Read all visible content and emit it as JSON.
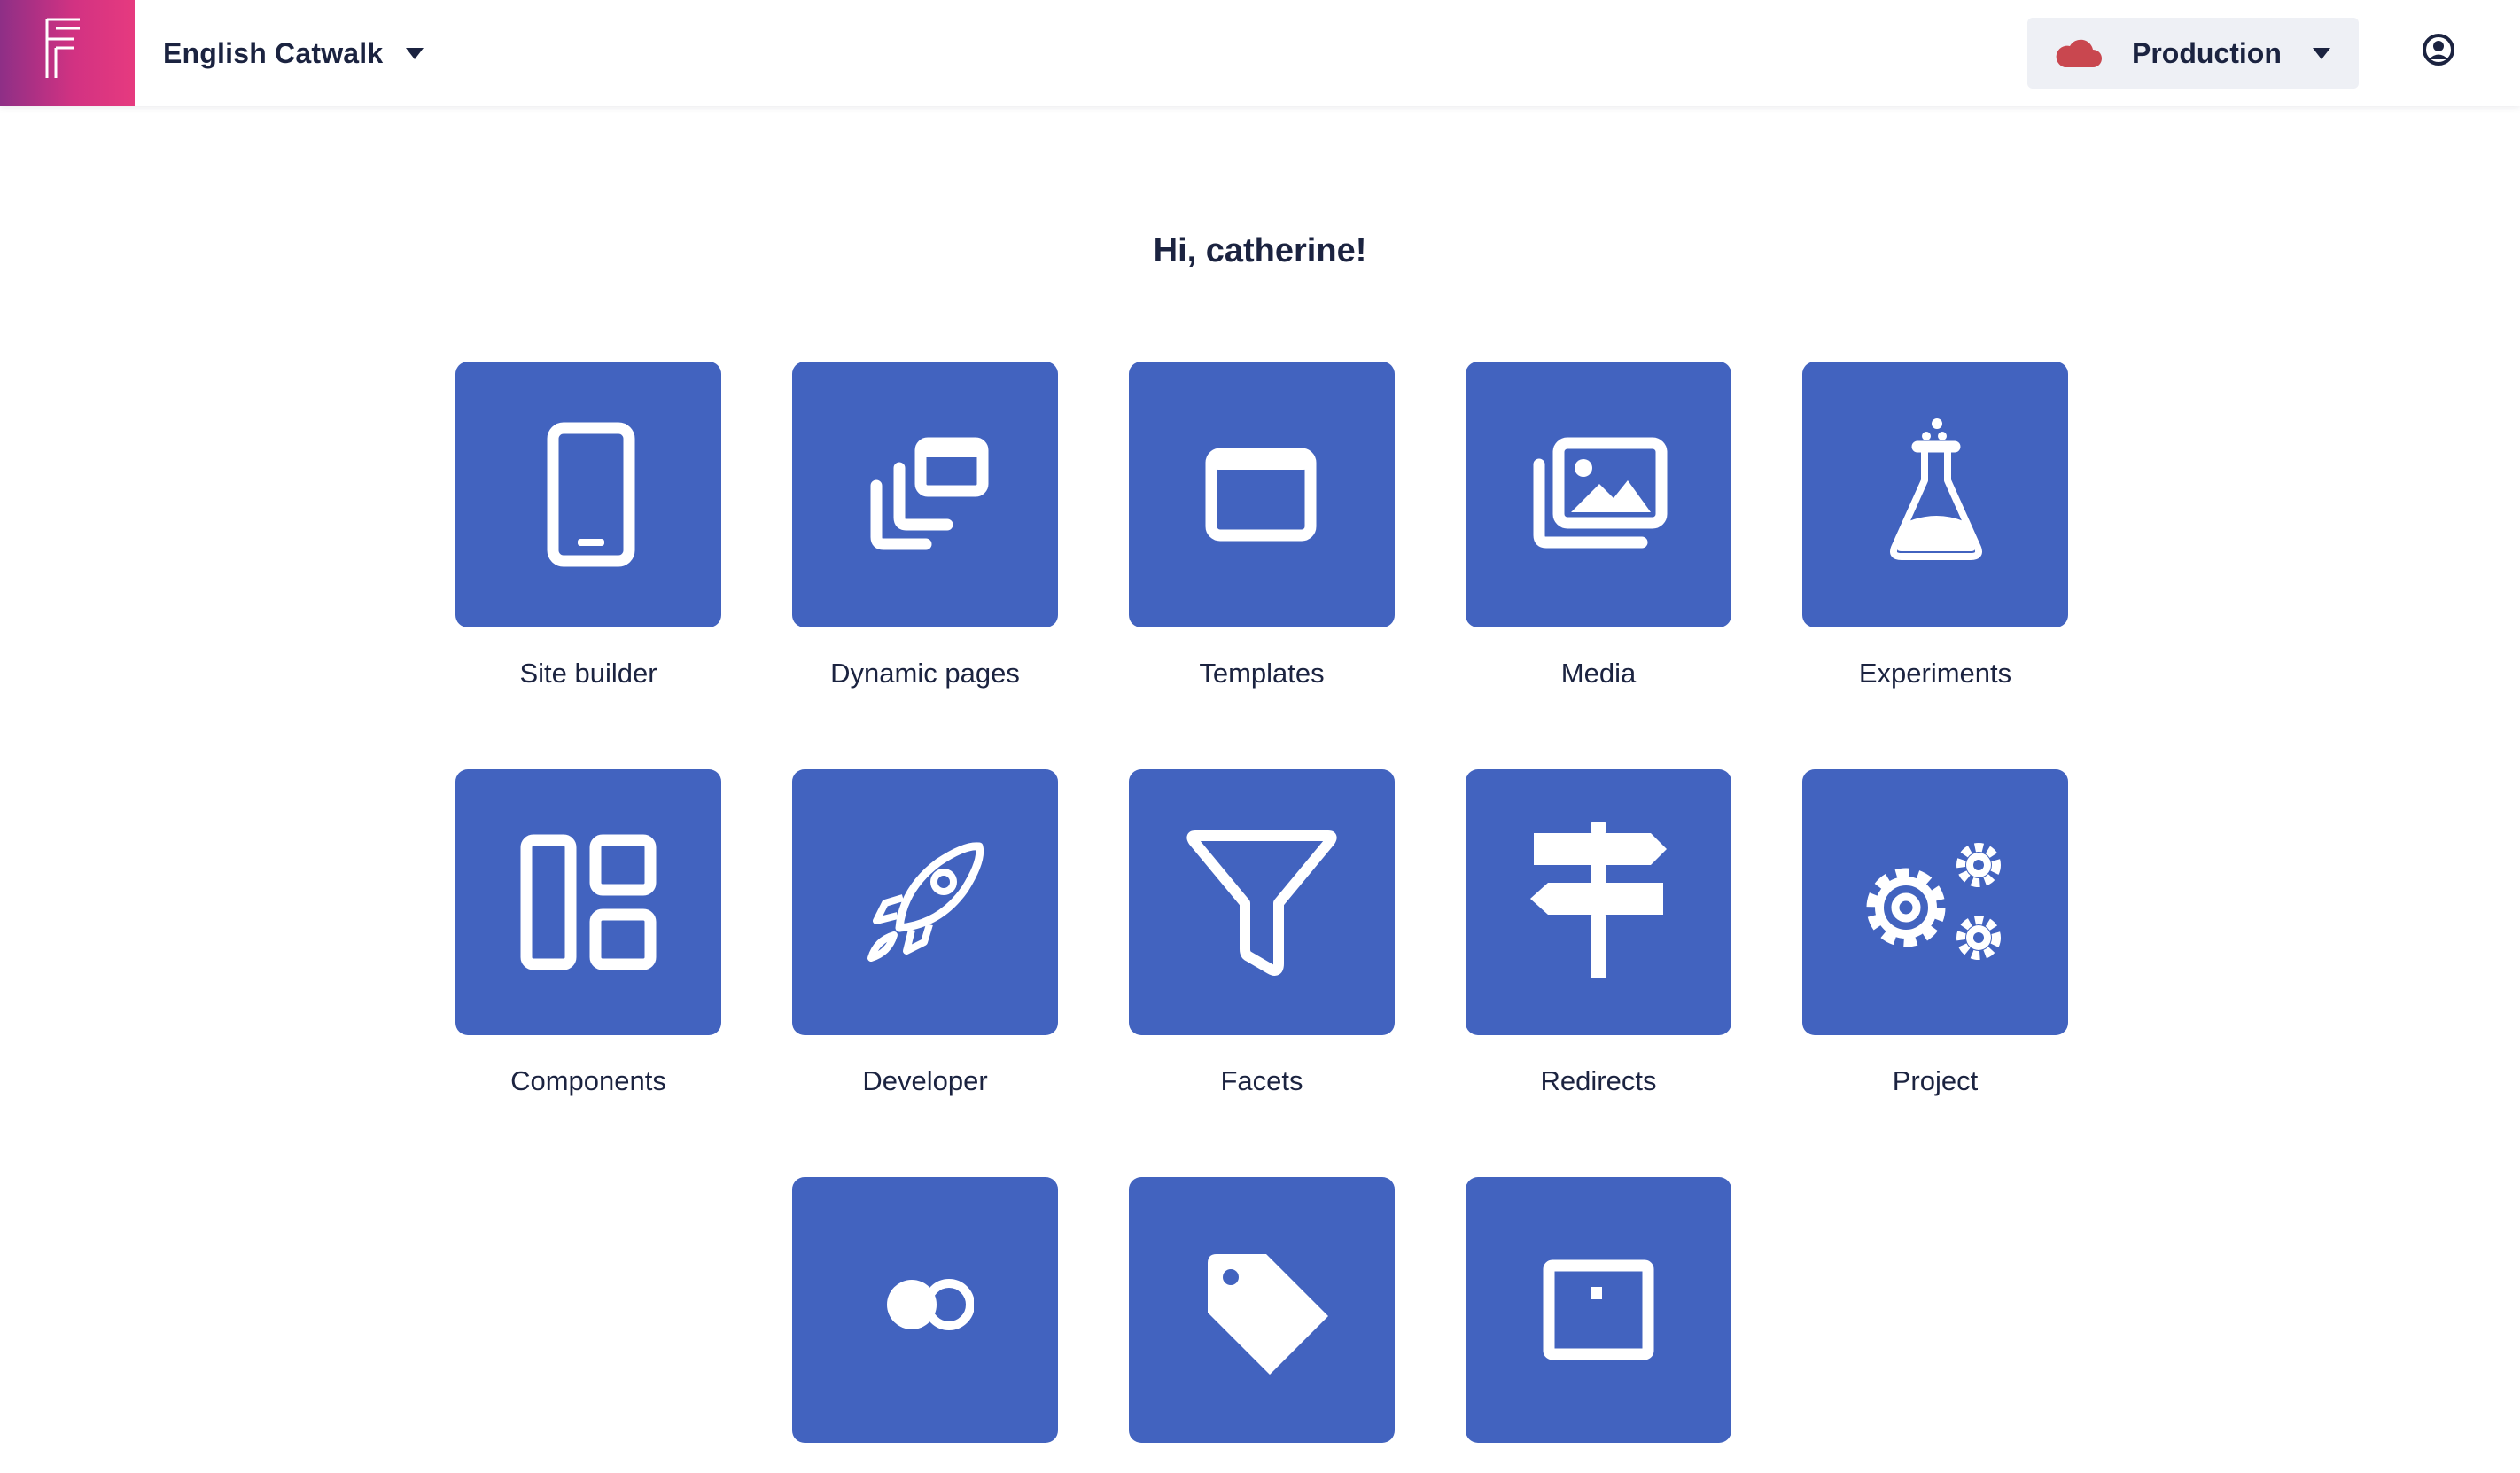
{
  "header": {
    "site_name": "English Catwalk",
    "environment": "Production",
    "brand_color": "#d23282",
    "environment_icon_color": "#c9474f"
  },
  "greeting": "Hi, catherine!",
  "tile_color": "#4263bf",
  "tiles": [
    {
      "label": "Site builder",
      "icon": "mobile-phone-icon"
    },
    {
      "label": "Dynamic pages",
      "icon": "stacked-windows-icon"
    },
    {
      "label": "Templates",
      "icon": "window-icon"
    },
    {
      "label": "Media",
      "icon": "images-icon"
    },
    {
      "label": "Experiments",
      "icon": "flask-icon"
    },
    {
      "label": "Components",
      "icon": "layout-blocks-icon"
    },
    {
      "label": "Developer",
      "icon": "rocket-icon"
    },
    {
      "label": "Facets",
      "icon": "filter-funnel-icon"
    },
    {
      "label": "Redirects",
      "icon": "signpost-icon"
    },
    {
      "label": "Project",
      "icon": "gears-icon"
    },
    {
      "label": "",
      "icon": "users-icon"
    },
    {
      "label": "",
      "icon": "tag-icon"
    },
    {
      "label": "",
      "icon": "board-icon"
    }
  ]
}
